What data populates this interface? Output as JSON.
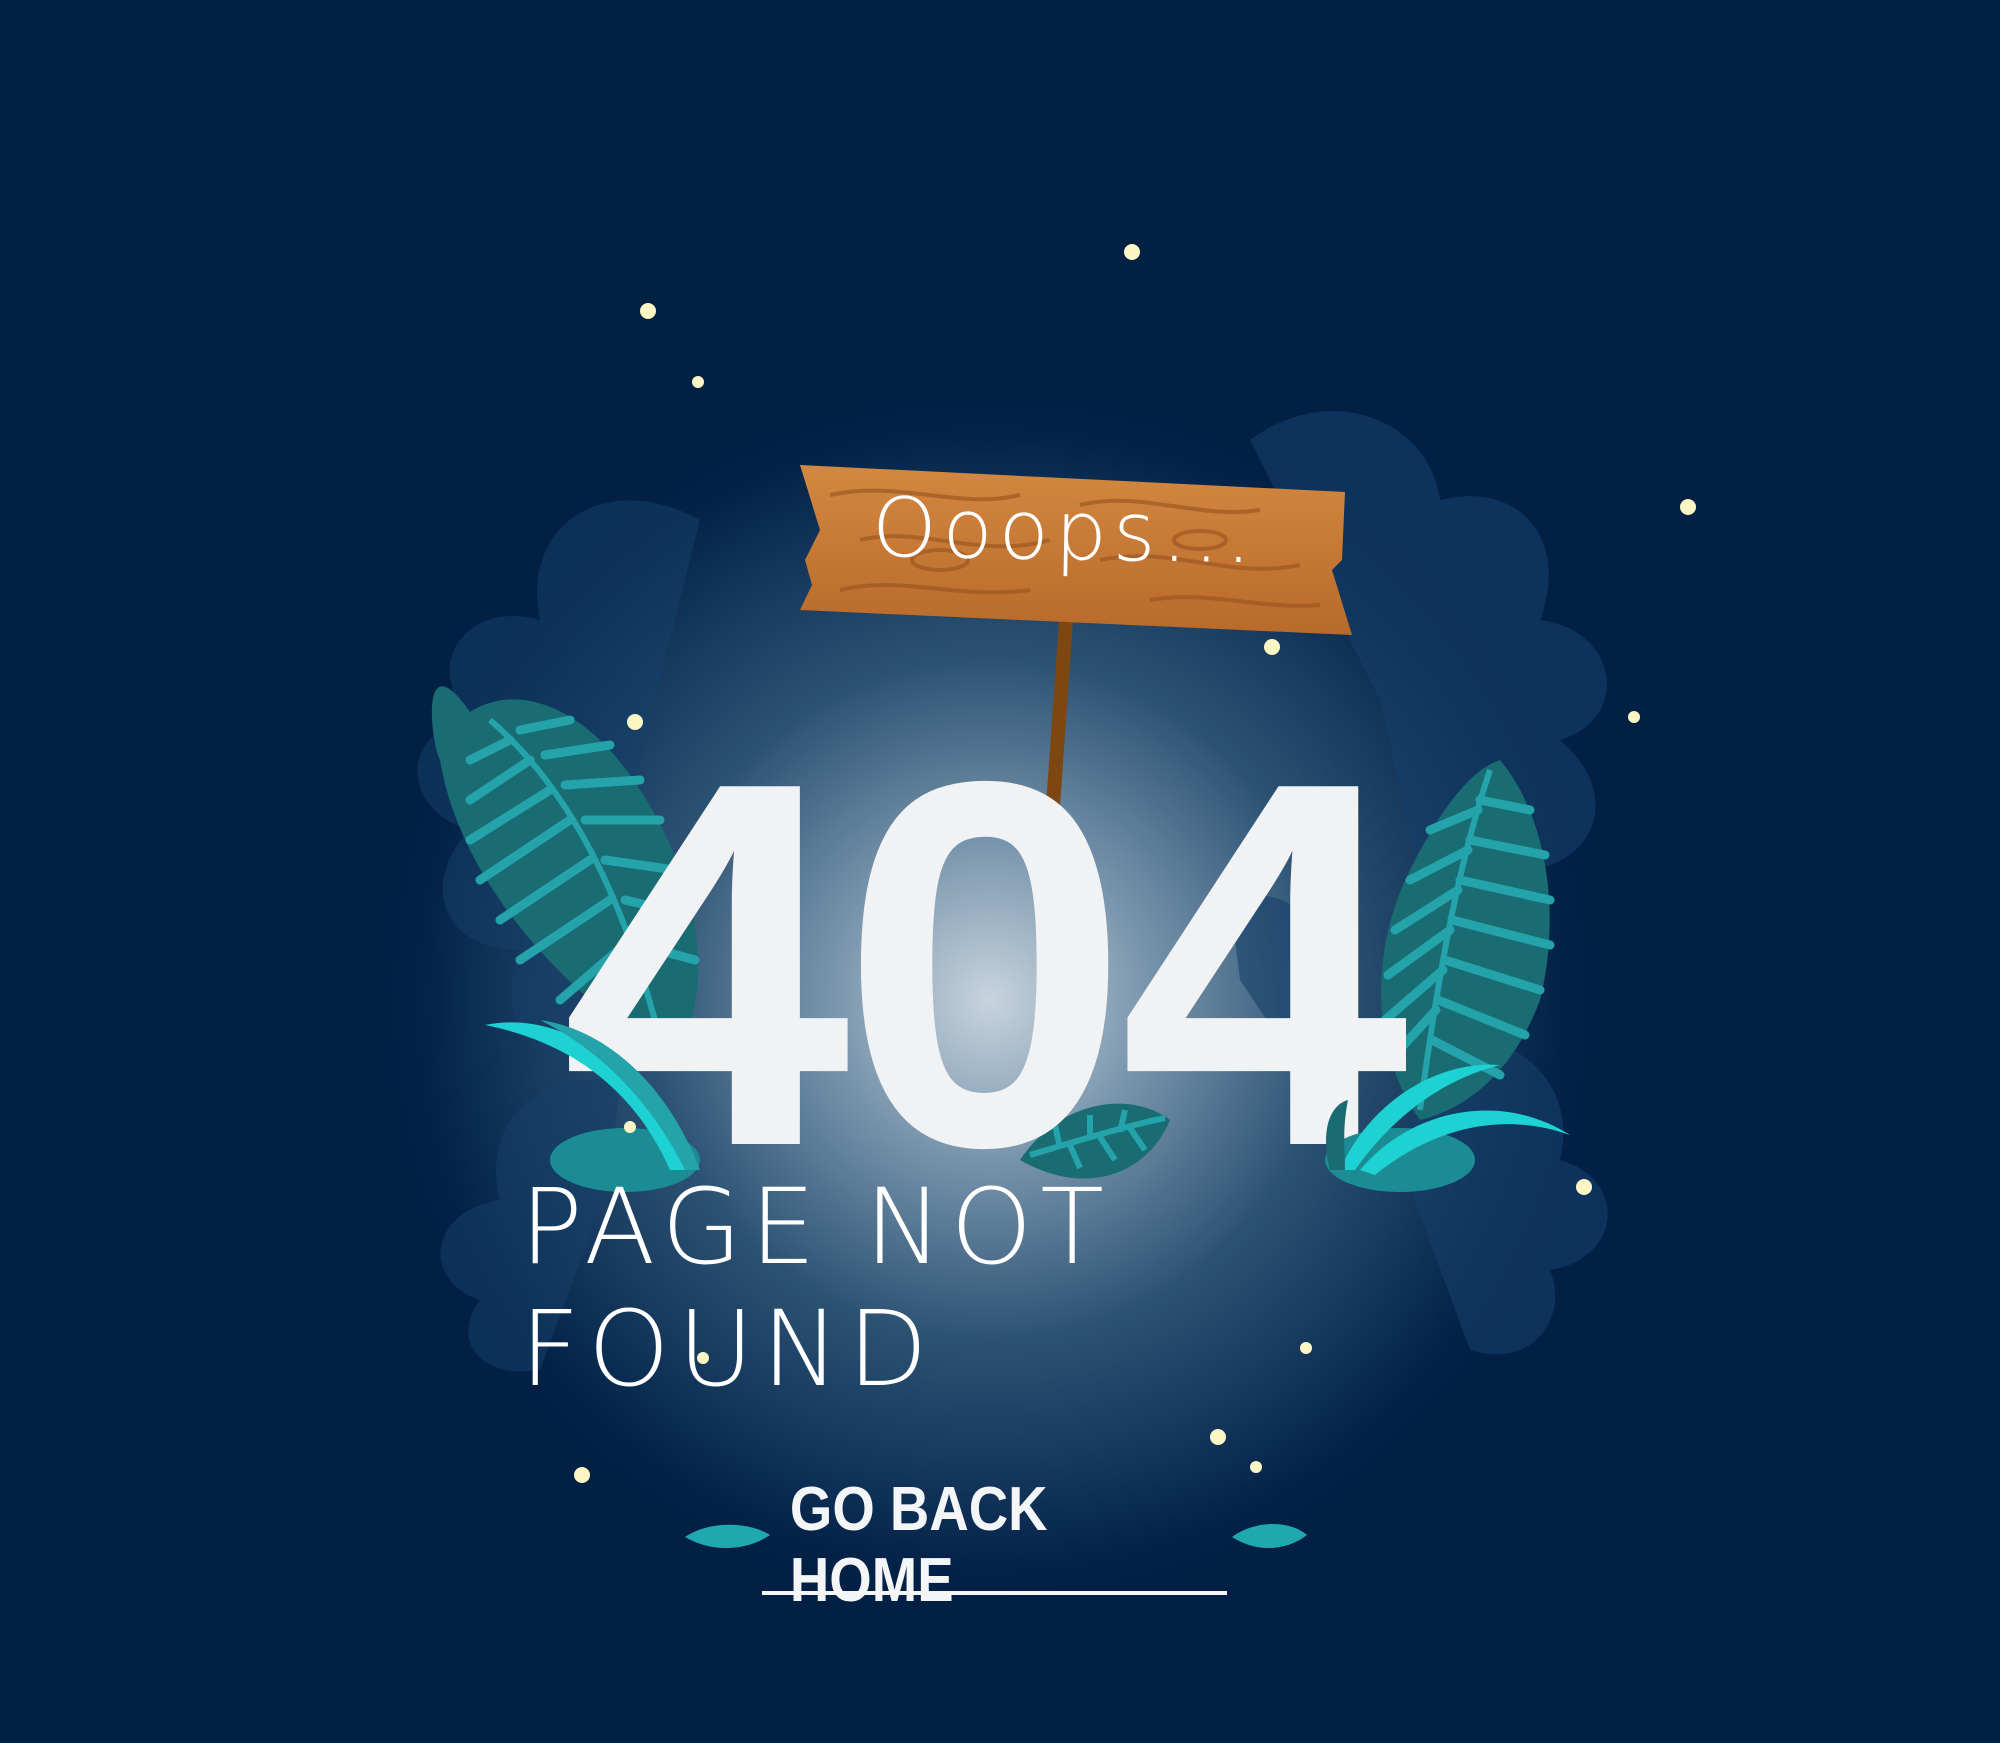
{
  "sign": {
    "text": "Ooops..."
  },
  "error_code": "404",
  "message": "PAGE NOT FOUND",
  "home_button": {
    "label": "GO BACK HOME"
  },
  "colors": {
    "background": "#021f44",
    "glow": "#c7d4de",
    "leaf_dark": "#1a6c73",
    "leaf_light": "#24a3ab",
    "grass": "#1ed1d3",
    "wood": "#c87733",
    "pole": "#7d4712",
    "text": "#f1f2f4",
    "stars": "#fbf6c4"
  },
  "icons": [
    "wooden-sign-icon",
    "leaf-icon",
    "grass-icon",
    "star-icon",
    "swoosh-icon"
  ]
}
